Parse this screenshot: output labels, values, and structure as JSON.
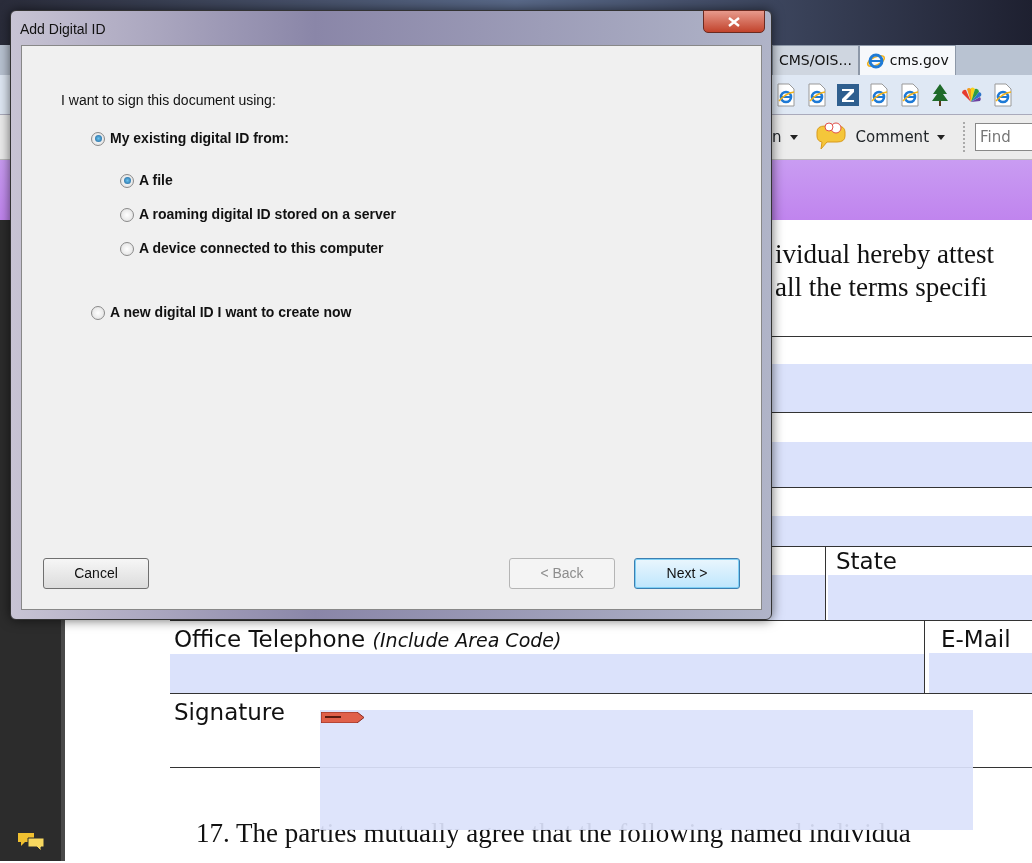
{
  "browser": {
    "tabs": [
      {
        "label": "CMS/OIS...",
        "selected": false
      },
      {
        "label": "cms.gov",
        "selected": true
      }
    ]
  },
  "toolbar": {
    "menu_fragment": "n",
    "comment": "Comment",
    "find_placeholder": "Find"
  },
  "document": {
    "lines": [
      "ividual hereby attest",
      "all the terms specifi"
    ],
    "fields": [
      {
        "label": "State"
      },
      {
        "label": "Office Telephone",
        "note": "(Include Area Code)"
      },
      {
        "label": "E-Mail"
      },
      {
        "label": "Signature"
      }
    ],
    "footer": "17. The parties mutually agree that the following named individua"
  },
  "dialog": {
    "title": "Add Digital ID",
    "prompt": "I want to sign this document using:",
    "options": [
      {
        "label": "My existing digital ID from:",
        "selected": true,
        "children": [
          {
            "label": "A file",
            "selected": true
          },
          {
            "label": "A roaming digital ID stored on a server",
            "selected": false
          },
          {
            "label": "A device connected to this computer",
            "selected": false
          }
        ]
      },
      {
        "label": "A new digital ID I want to create now",
        "selected": false
      }
    ],
    "buttons": [
      {
        "label": "Cancel",
        "disabled": false,
        "focused": false
      },
      {
        "label": "< Back",
        "disabled": true,
        "focused": false
      },
      {
        "label": "Next >",
        "disabled": false,
        "focused": true
      }
    ]
  }
}
